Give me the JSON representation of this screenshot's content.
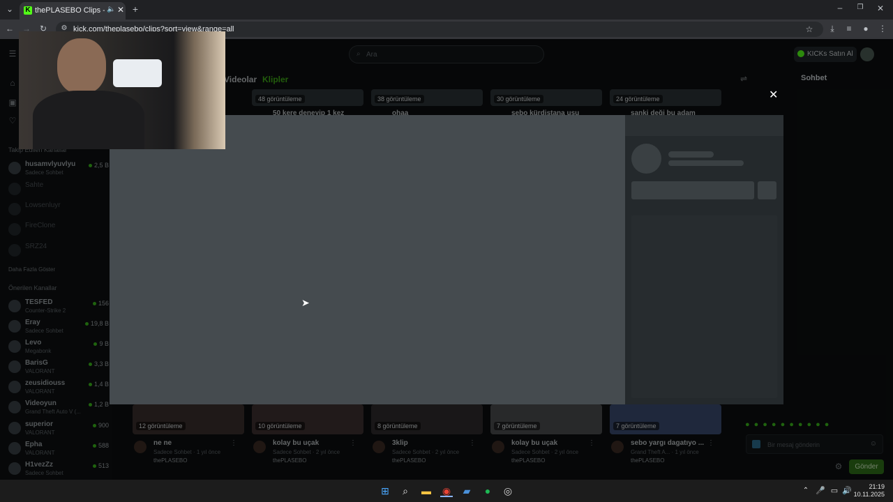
{
  "browser": {
    "tab_title": "thePLASEBO Clips - Watch",
    "tab_favicon": "K",
    "url": "kick.com/theplasebo/clips?sort=view&range=all"
  },
  "header": {
    "search_placeholder": "Ara",
    "kicks_button": "KICKs Satın Al"
  },
  "channel_tabs": {
    "videos": "Videolar",
    "clips": "Klipler"
  },
  "sidebar": {
    "followed_heading": "Takip Edilen Kanallar",
    "followed": [
      {
        "name": "husamvlyuvlyu",
        "category": "Sadece Sohbet",
        "viewers": "2,5 B"
      },
      {
        "name": "Sahte",
        "category": "",
        "viewers": ""
      },
      {
        "name": "Lowsenluyr",
        "category": "",
        "viewers": ""
      },
      {
        "name": "FireClone",
        "category": "",
        "viewers": ""
      },
      {
        "name": "SRZ24",
        "category": "",
        "viewers": ""
      }
    ],
    "show_more": "Daha Fazla Göster",
    "recommended_heading": "Önerilen Kanallar",
    "recommended": [
      {
        "name": "TESFED",
        "category": "Counter-Strike 2",
        "viewers": "156"
      },
      {
        "name": "Eray",
        "category": "Sadece Sohbet",
        "viewers": "19,8 B"
      },
      {
        "name": "Levo",
        "category": "Megabonk",
        "viewers": "9 B"
      },
      {
        "name": "BarisG",
        "category": "VALORANT",
        "viewers": "3,3 B"
      },
      {
        "name": "zeusidiouss",
        "category": "VALORANT",
        "viewers": "1,4 B"
      },
      {
        "name": "Videoyun",
        "category": "Grand Theft Auto V (...",
        "viewers": "1,2 B"
      },
      {
        "name": "superior",
        "category": "VALORANT",
        "viewers": "900"
      },
      {
        "name": "Epha",
        "category": "VALORANT",
        "viewers": "588"
      },
      {
        "name": "H1vezZz",
        "category": "Sadece Sohbet",
        "viewers": "513"
      }
    ]
  },
  "top_clips": [
    {
      "views": "48 görüntüleme",
      "title": "50 kere deneyip 1 kez"
    },
    {
      "views": "38 görüntüleme",
      "title": "ohaa"
    },
    {
      "views": "30 görüntüleme",
      "title": "sebo kürdistana usu"
    },
    {
      "views": "24 görüntüleme",
      "title": "sanki deği bu adam"
    }
  ],
  "bottom_clips": [
    {
      "views": "12 görüntüleme",
      "title": "ne ne",
      "meta": "Sadece Sohbet · 1 yıl önce",
      "channel": "thePLASEBO"
    },
    {
      "views": "10 görüntüleme",
      "title": "kolay bu uçak",
      "meta": "Sadece Sohbet · 2 yıl önce",
      "channel": "thePLASEBO"
    },
    {
      "views": "8 görüntüleme",
      "title": "3klip",
      "meta": "Sadece Sohbet · 2 yıl önce",
      "channel": "thePLASEBO"
    },
    {
      "views": "7 görüntüleme",
      "title": "kolay bu uçak",
      "meta": "Sadece Sohbet · 2 yıl önce",
      "channel": "thePLASEBO"
    },
    {
      "views": "7 görüntüleme",
      "title": "sebo yargı dagatıyo ...",
      "meta": "Grand Theft A... · 1 yıl önce",
      "channel": "thePLASEBO"
    }
  ],
  "chat": {
    "title": "Sohbet",
    "input_placeholder": "Bir mesaj gönderin",
    "send_label": "Gönder"
  },
  "taskbar": {
    "time": "21:19",
    "date": "10.11.2025"
  },
  "colors": {
    "accent": "#53fc18",
    "modal_video": "#454b4f",
    "modal_side": "#24292c"
  }
}
